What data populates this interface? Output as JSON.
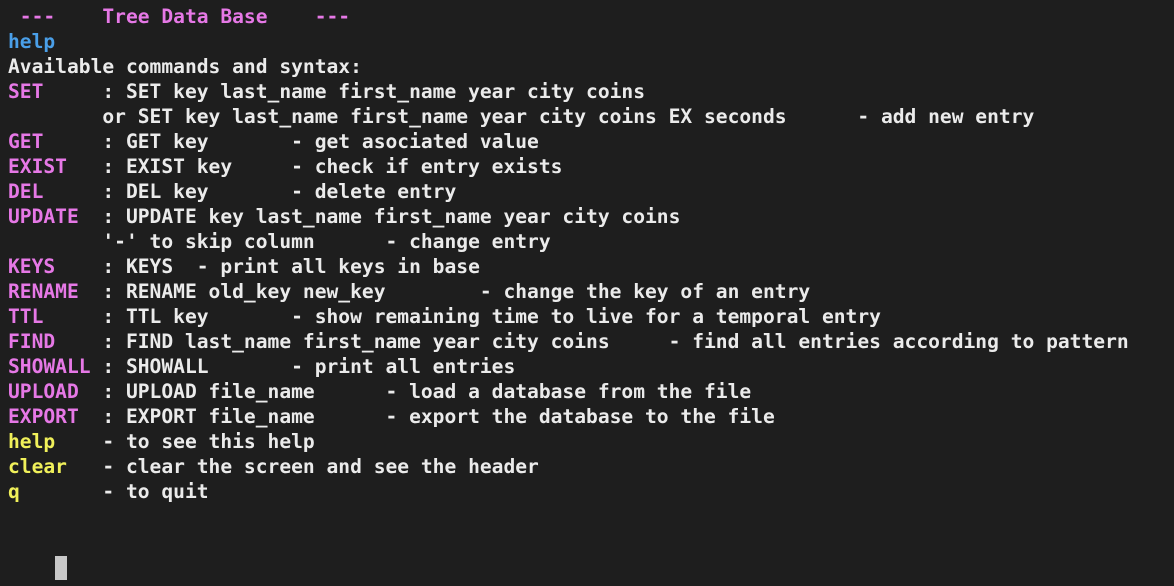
{
  "header": " ---    Tree Data Base    ---",
  "typed_command": "help",
  "intro": "Available commands and syntax:",
  "commands": [
    {
      "name": "SET     ",
      "desc": ": SET key last_name first_name year city coins",
      "color": "pink"
    },
    {
      "name": "        ",
      "desc": "or SET key last_name first_name year city coins EX seconds      - add new entry",
      "color": "pink"
    },
    {
      "name": "GET     ",
      "desc": ": GET key       - get asociated value",
      "color": "pink"
    },
    {
      "name": "EXIST   ",
      "desc": ": EXIST key     - check if entry exists",
      "color": "pink"
    },
    {
      "name": "DEL     ",
      "desc": ": DEL key       - delete entry",
      "color": "pink"
    },
    {
      "name": "UPDATE  ",
      "desc": ": UPDATE key last_name first_name year city coins",
      "color": "pink"
    },
    {
      "name": "        ",
      "desc": "'-' to skip column      - change entry",
      "color": "pink"
    },
    {
      "name": "KEYS    ",
      "desc": ": KEYS  - print all keys in base",
      "color": "pink"
    },
    {
      "name": "RENAME  ",
      "desc": ": RENAME old_key new_key        - change the key of an entry",
      "color": "pink"
    },
    {
      "name": "TTL     ",
      "desc": ": TTL key       - show remaining time to live for a temporal entry",
      "color": "pink"
    },
    {
      "name": "FIND    ",
      "desc": ": FIND last_name first_name year city coins     - find all entries according to pattern",
      "color": "pink"
    },
    {
      "name": "SHOWALL ",
      "desc": ": SHOWALL       - print all entries",
      "color": "pink"
    },
    {
      "name": "UPLOAD  ",
      "desc": ": UPLOAD file_name      - load a database from the file",
      "color": "pink"
    },
    {
      "name": "EXPORT  ",
      "desc": ": EXPORT file_name      - export the database to the file",
      "color": "pink"
    },
    {
      "name": "help    ",
      "desc": "- to see this help",
      "color": "yellow"
    },
    {
      "name": "clear   ",
      "desc": "- clear the screen and see the header",
      "color": "yellow"
    },
    {
      "name": "q       ",
      "desc": "- to quit",
      "color": "yellow"
    }
  ],
  "colors": {
    "background": "#1e1e1e",
    "text": "#ebebeb",
    "command_name": "#e678e6",
    "typed_command": "#4a9fe8",
    "shortcut": "#f0f05a",
    "cursor": "#c8c8c8"
  }
}
